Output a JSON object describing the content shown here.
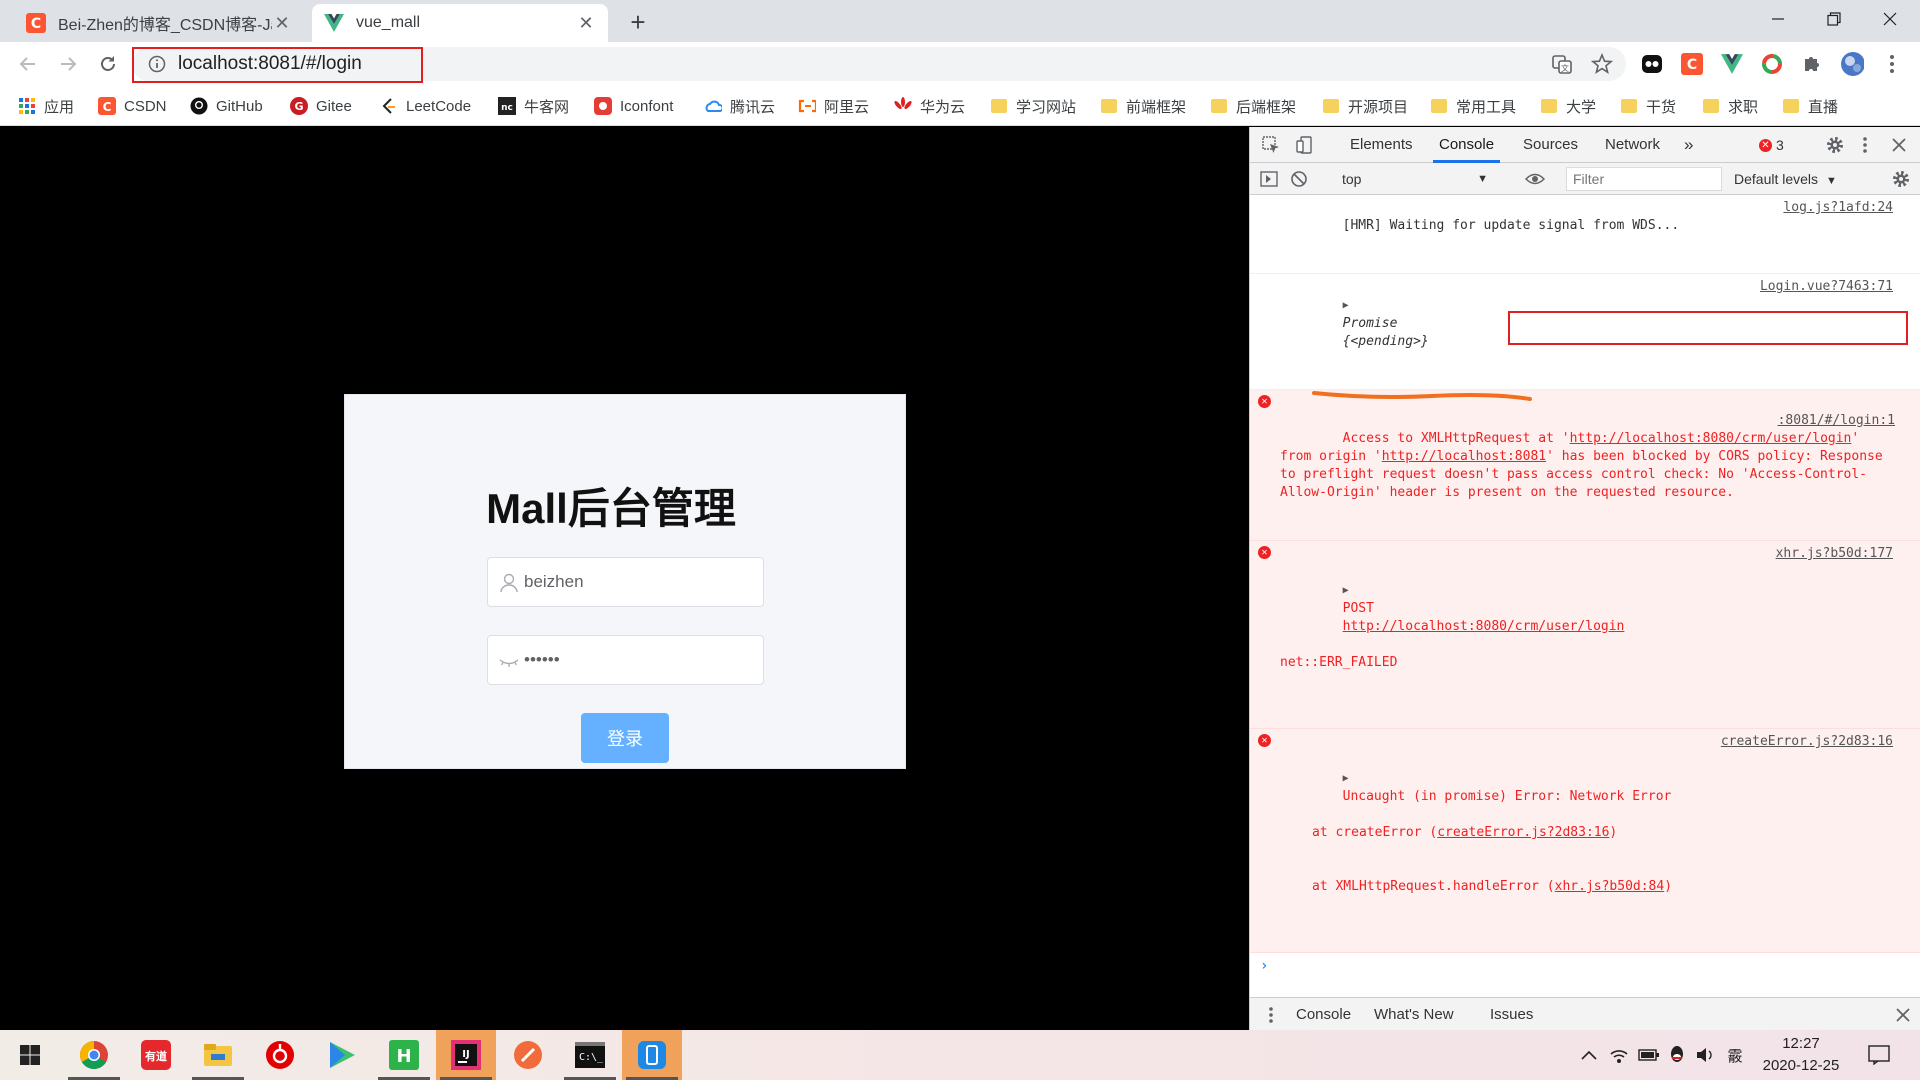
{
  "browser": {
    "tabs": [
      {
        "title": "Bei-Zhen的博客_CSDN博客-Jav",
        "favicon": "csdn-icon",
        "active": false
      },
      {
        "title": "vue_mall",
        "favicon": "vue-icon",
        "active": true
      }
    ],
    "url": "localhost:8081/#/login",
    "bookmarks": [
      {
        "label": "应用",
        "icon": "apps-grid-icon"
      },
      {
        "label": "CSDN",
        "icon": "csdn-icon"
      },
      {
        "label": "GitHub",
        "icon": "github-icon"
      },
      {
        "label": "Gitee",
        "icon": "gitee-icon"
      },
      {
        "label": "LeetCode",
        "icon": "leetcode-icon"
      },
      {
        "label": "牛客网",
        "icon": "nowcoder-icon"
      },
      {
        "label": "Iconfont",
        "icon": "iconfont-icon"
      },
      {
        "label": "腾讯云",
        "icon": "tencent-cloud-icon"
      },
      {
        "label": "阿里云",
        "icon": "aliyun-icon"
      },
      {
        "label": "华为云",
        "icon": "huawei-cloud-icon"
      },
      {
        "label": "学习网站",
        "icon": "folder-icon"
      },
      {
        "label": "前端框架",
        "icon": "folder-icon"
      },
      {
        "label": "后端框架",
        "icon": "folder-icon"
      },
      {
        "label": "开源项目",
        "icon": "folder-icon"
      },
      {
        "label": "常用工具",
        "icon": "folder-icon"
      },
      {
        "label": "大学",
        "icon": "folder-icon"
      },
      {
        "label": "干货",
        "icon": "folder-icon"
      },
      {
        "label": "求职",
        "icon": "folder-icon"
      },
      {
        "label": "直播",
        "icon": "folder-icon"
      }
    ]
  },
  "page": {
    "title": "Mall后台管理",
    "username": "beizhen",
    "password_mask": "••••••",
    "login_button": "登录"
  },
  "devtools": {
    "tabs": [
      "Elements",
      "Console",
      "Sources",
      "Network"
    ],
    "active_tab": "Console",
    "more": "»",
    "error_count": "3",
    "context": "top",
    "filter_placeholder": "Filter",
    "levels": "Default levels",
    "messages": [
      {
        "type": "log",
        "text": "[HMR] Waiting for update signal from WDS...",
        "source": "log.js?1afd:24"
      },
      {
        "type": "log",
        "prefix": "Promise",
        "text": "{<pending>}",
        "source": "Login.vue?7463:71"
      },
      {
        "type": "error",
        "part1": "Access to XMLHttpRequest at '",
        "link1": "http://localhost:8080/crm/user/login",
        "part2": "' from origin '",
        "link2": "http://localhost:8081",
        "part3": "' has been blocked by CORS policy: Response to preflight request doesn't pass access control check: No '",
        "highlight": "Access-Control-Allow-Origin",
        "part4": "' header is present on the requested resource.",
        "source": ":8081/#/login:1"
      },
      {
        "type": "error",
        "method": "POST",
        "link": "http://localhost:8080/crm/user/login",
        "line2": "net::ERR_FAILED",
        "source": "xhr.js?b50d:177"
      },
      {
        "type": "error",
        "text": "Uncaught (in promise) Error: Network Error",
        "source": "createError.js?2d83:16",
        "at1_prefix": "at createError (",
        "at1_link": "createError.js?2d83:16",
        "at2_prefix": "at XMLHttpRequest.handleError (",
        "at2_link": "xhr.js?b50d:84"
      }
    ],
    "prompt": "›",
    "drawer_tabs": [
      "Console",
      "What's New",
      "Issues"
    ]
  },
  "taskbar": {
    "apps": [
      "windows-start-icon",
      "chrome-icon",
      "youdao-icon",
      "file-explorer-icon",
      "netease-music-icon",
      "video-player-icon",
      "hbuilder-icon",
      "intellij-idea-icon",
      "postman-icon",
      "terminal-icon",
      "phone-app-icon"
    ],
    "time": "12:27",
    "date": "2020-12-25",
    "ime": "霰"
  }
}
